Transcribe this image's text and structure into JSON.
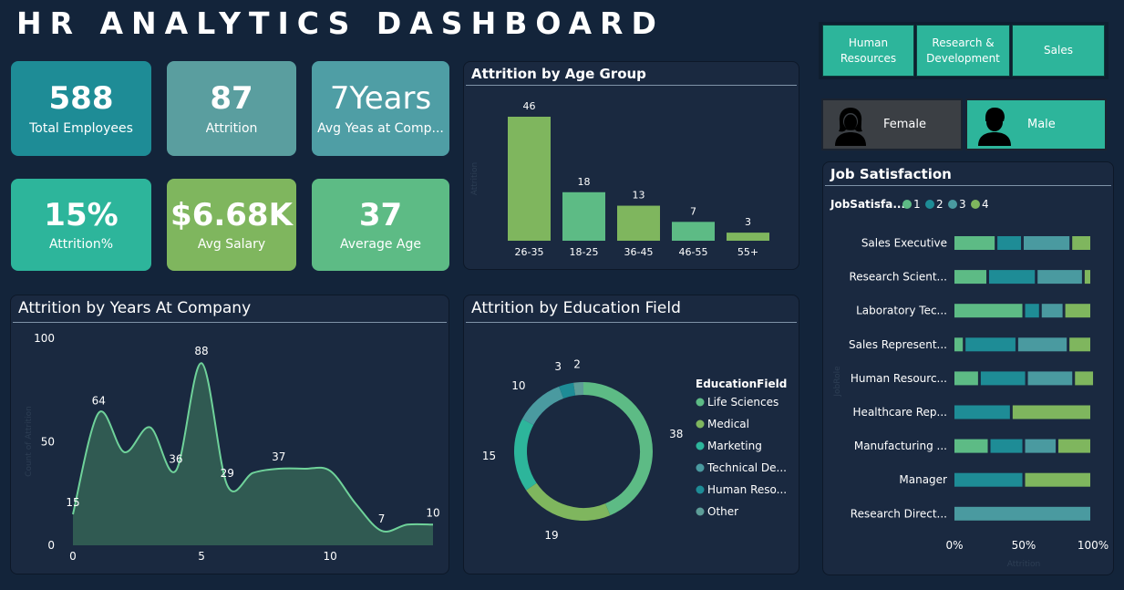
{
  "title": "HR ANALYTICS DASHBOARD",
  "kpis": {
    "total_employees": {
      "value": "588",
      "label": "Total Employees"
    },
    "attrition": {
      "value": "87",
      "label": "Attrition"
    },
    "avg_years": {
      "value": "7Years",
      "label": "Avg Yeas at Comp..."
    },
    "attrition_pct": {
      "value": "15%",
      "label": "Attrition%"
    },
    "avg_salary": {
      "value": "$6.68K",
      "label": "Avg Salary"
    },
    "avg_age": {
      "value": "37",
      "label": "Average Age"
    }
  },
  "departments": {
    "hr": "Human Resources",
    "rnd": "Research & Development",
    "sales": "Sales"
  },
  "gender": {
    "female": "Female",
    "male": "Male"
  },
  "colors": {
    "background": "#13243a",
    "panel": "#1a2940",
    "teal": "#2db59b",
    "green": "#7fb65e",
    "mid_green": "#5dbb85",
    "dark_teal": "#1e8c96",
    "slate_teal": "#4a9aa0"
  },
  "chart_data": [
    {
      "type": "bar",
      "title": "Attrition by Age Group",
      "categories": [
        "26-35",
        "18-25",
        "36-45",
        "46-55",
        "55+"
      ],
      "values": [
        46,
        18,
        13,
        7,
        3
      ],
      "ylabel": "Attrition",
      "colors": [
        "#7fb65e",
        "#5dbb85",
        "#7fb65e",
        "#5dbb85",
        "#7fb65e"
      ]
    },
    {
      "type": "area",
      "title": "Attrition by Years At Company",
      "x": [
        0,
        1,
        2,
        3,
        4,
        5,
        6,
        7,
        8,
        9,
        10,
        11,
        12,
        13,
        14
      ],
      "y": [
        15,
        64,
        45,
        57,
        36,
        88,
        29,
        35,
        37,
        37,
        36,
        20,
        7,
        10,
        10
      ],
      "labeled_points": [
        {
          "x": 0,
          "label": "15"
        },
        {
          "x": 1,
          "label": "64"
        },
        {
          "x": 4,
          "label": "36"
        },
        {
          "x": 5,
          "label": "88"
        },
        {
          "x": 6,
          "label": "29"
        },
        {
          "x": 8,
          "label": "37"
        },
        {
          "x": 12,
          "label": "7"
        },
        {
          "x": 14,
          "label": "10"
        }
      ],
      "xticks": [
        "0",
        "5",
        "10"
      ],
      "yticks": [
        "0",
        "50",
        "100"
      ],
      "xlim": [
        0,
        14
      ],
      "ylim": [
        0,
        100
      ],
      "ylabel": "Count of Attrition",
      "grid": false
    },
    {
      "type": "pie",
      "title": "Attrition by Education Field",
      "donut": true,
      "legend_title": "EducationField",
      "legend_position": "right",
      "slices": [
        {
          "label": "Life Sciences",
          "value": 38,
          "color": "#5dbb85"
        },
        {
          "label": "Medical",
          "value": 19,
          "color": "#7fb65e"
        },
        {
          "label": "Marketing",
          "value": 15,
          "color": "#2db59b"
        },
        {
          "label": "Technical De...",
          "value": 10,
          "color": "#4a9aa0"
        },
        {
          "label": "Human Reso...",
          "value": 3,
          "color": "#1e8c96"
        },
        {
          "label": "Other",
          "value": 2,
          "color": "#5d9d98"
        }
      ]
    },
    {
      "type": "bar",
      "orientation": "horizontal",
      "stacked": "100%",
      "title": "Job Satisfaction",
      "legend_title": "JobSatisfa...",
      "legend_position": "top",
      "categories": [
        "Sales Executive",
        "Research Scient...",
        "Laboratory Tec...",
        "Sales Represent...",
        "Human Resourc...",
        "Healthcare Rep...",
        "Manufacturing ...",
        "Manager",
        "Research Direct..."
      ],
      "series": [
        {
          "name": "1",
          "color": "#5dbb85",
          "values": [
            0.31,
            0.25,
            0.51,
            0.08,
            0.19,
            0,
            0.26,
            0,
            0
          ]
        },
        {
          "name": "2",
          "color": "#1e8c96",
          "values": [
            0.19,
            0.35,
            0.12,
            0.38,
            0.34,
            0.42,
            0.25,
            0.51,
            0
          ]
        },
        {
          "name": "3",
          "color": "#4a9aa0",
          "values": [
            0.35,
            0.34,
            0.17,
            0.37,
            0.34,
            0,
            0.24,
            0,
            1.0
          ]
        },
        {
          "name": "4",
          "color": "#7fb65e",
          "values": [
            0.15,
            0.06,
            0.2,
            0.17,
            0.15,
            0.58,
            0.25,
            0.49,
            0
          ]
        }
      ],
      "xticks": [
        "0%",
        "50%",
        "100%"
      ],
      "xlim": [
        0,
        1
      ],
      "ylabel": "JobRole",
      "xlabel": "Attrition"
    }
  ]
}
